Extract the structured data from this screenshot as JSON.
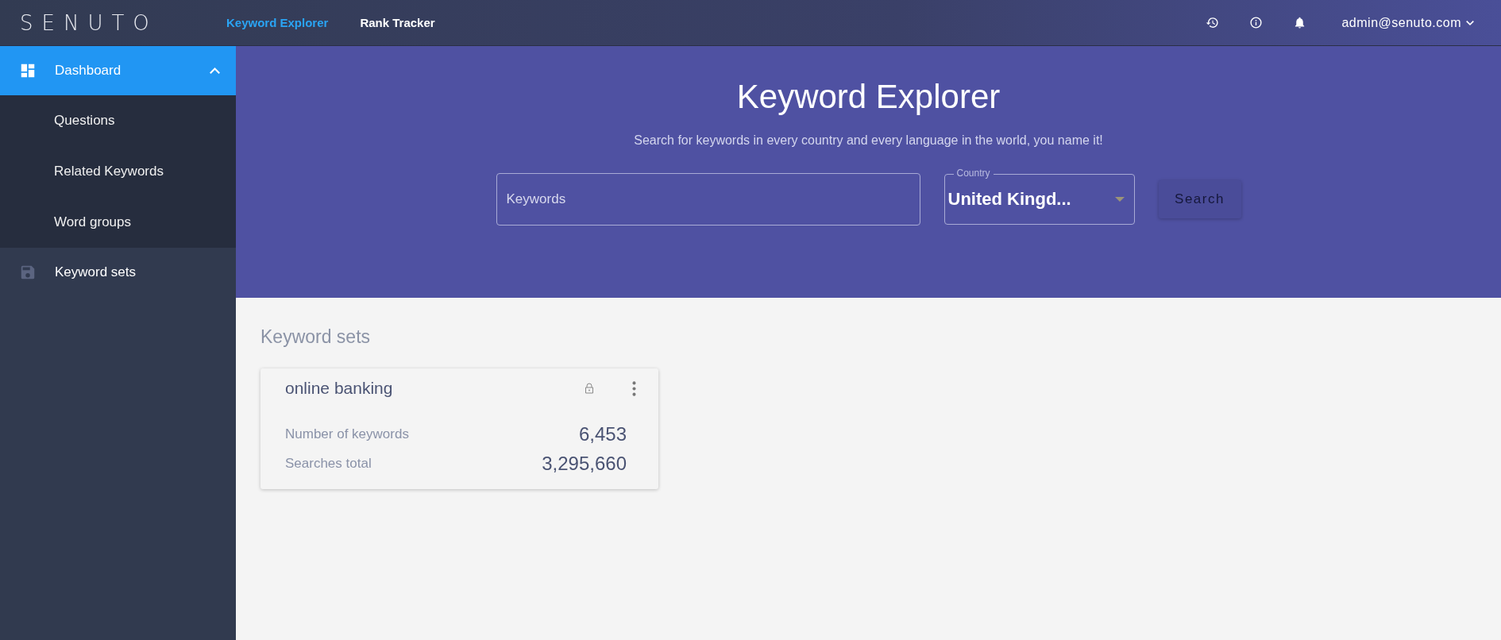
{
  "topbar": {
    "logo": "SENUTO",
    "nav": [
      {
        "label": "Keyword Explorer",
        "selected": true
      },
      {
        "label": "Rank Tracker",
        "selected": false
      }
    ],
    "user": "admin@senuto.com"
  },
  "sidebar": {
    "items": [
      {
        "label": "Dashboard",
        "selected": true,
        "expanded": true,
        "children": [
          {
            "label": "Questions",
            "selected": false
          },
          {
            "label": "Related Keywords",
            "selected": false
          },
          {
            "label": "Word groups",
            "selected": false
          }
        ]
      },
      {
        "label": "Keyword sets",
        "selected": false
      }
    ]
  },
  "hero": {
    "title": "Keyword Explorer",
    "subtitle": "Search for keywords in every country and every language in the world, you name it!",
    "keywords_field": {
      "placeholder": "Keywords"
    },
    "country_field": {
      "label": "Country",
      "value": "United Kingd..."
    },
    "search_button": {
      "label": "Search",
      "disabled": true
    }
  },
  "keyword_sets": {
    "title": "Keyword sets",
    "cards": [
      {
        "name": "online banking",
        "locked": true,
        "stats": [
          {
            "label": "Number of keywords",
            "value": "6,453"
          },
          {
            "label": "Searches total",
            "value": "3,295,660"
          }
        ]
      }
    ]
  }
}
